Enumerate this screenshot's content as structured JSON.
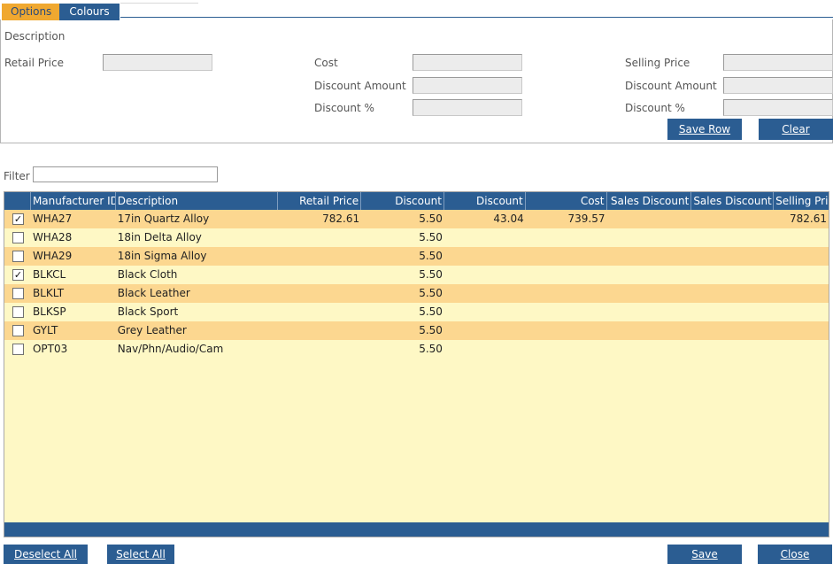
{
  "tabs": {
    "options": "Options",
    "colours": "Colours"
  },
  "form": {
    "description_label": "Description",
    "retail_price_label": "Retail Price",
    "retail_price_value": "",
    "cost_label": "Cost",
    "cost_value": "",
    "discount_amount_label": "Discount Amount",
    "discount_amount_value": "",
    "discount_pct_label": "Discount %",
    "discount_pct_value": "",
    "selling_price_label": "Selling Price",
    "selling_price_value": "",
    "sales_discount_amount_label": "Discount Amount",
    "sales_discount_amount_value": "",
    "sales_discount_pct_label": "Discount %",
    "sales_discount_pct_value": "",
    "save_row_label": "Save Row",
    "clear_label": "Clear"
  },
  "filter": {
    "label": "Filter",
    "value": ""
  },
  "grid": {
    "columns": [
      "Manufacturer ID",
      "Description",
      "Retail Price",
      "Discount",
      "Discount",
      "Cost",
      "Sales Discount",
      "Sales Discount",
      "Selling Price"
    ],
    "rows": [
      {
        "checked": true,
        "mark": "✓",
        "id": "WHA27",
        "description": "17in Quartz Alloy",
        "retail_price": "782.61",
        "discount": "5.50",
        "discount_amt": "43.04",
        "cost": "739.57",
        "sales_discount": "",
        "sales_discount_amt": "",
        "selling_price": "782.61"
      },
      {
        "checked": false,
        "mark": "",
        "id": "WHA28",
        "description": "18in Delta Alloy",
        "retail_price": "",
        "discount": "5.50",
        "discount_amt": "",
        "cost": "",
        "sales_discount": "",
        "sales_discount_amt": "",
        "selling_price": ""
      },
      {
        "checked": false,
        "mark": "",
        "id": "WHA29",
        "description": "18in Sigma Alloy",
        "retail_price": "",
        "discount": "5.50",
        "discount_amt": "",
        "cost": "",
        "sales_discount": "",
        "sales_discount_amt": "",
        "selling_price": ""
      },
      {
        "checked": true,
        "mark": "✓",
        "id": "BLKCL",
        "description": "Black Cloth",
        "retail_price": "",
        "discount": "5.50",
        "discount_amt": "",
        "cost": "",
        "sales_discount": "",
        "sales_discount_amt": "",
        "selling_price": ""
      },
      {
        "checked": false,
        "mark": "",
        "id": "BLKLT",
        "description": "Black Leather",
        "retail_price": "",
        "discount": "5.50",
        "discount_amt": "",
        "cost": "",
        "sales_discount": "",
        "sales_discount_amt": "",
        "selling_price": ""
      },
      {
        "checked": false,
        "mark": "",
        "id": "BLKSP",
        "description": "Black Sport",
        "retail_price": "",
        "discount": "5.50",
        "discount_amt": "",
        "cost": "",
        "sales_discount": "",
        "sales_discount_amt": "",
        "selling_price": ""
      },
      {
        "checked": false,
        "mark": "",
        "id": "GYLT",
        "description": "Grey Leather",
        "retail_price": "",
        "discount": "5.50",
        "discount_amt": "",
        "cost": "",
        "sales_discount": "",
        "sales_discount_amt": "",
        "selling_price": ""
      },
      {
        "checked": false,
        "mark": "",
        "id": "OPT03",
        "description": "Nav/Phn/Audio/Cam",
        "retail_price": "",
        "discount": "5.50",
        "discount_amt": "",
        "cost": "",
        "sales_discount": "",
        "sales_discount_amt": "",
        "selling_price": ""
      }
    ]
  },
  "footer": {
    "deselect_all_label": "Deselect All",
    "select_all_label": "Select All",
    "save_label": "Save",
    "close_label": "Close"
  },
  "colors": {
    "primary": "#2b5d92",
    "accent": "#f0a830",
    "row_alt": "#fcd790",
    "grid_bg": "#fef8c5"
  }
}
